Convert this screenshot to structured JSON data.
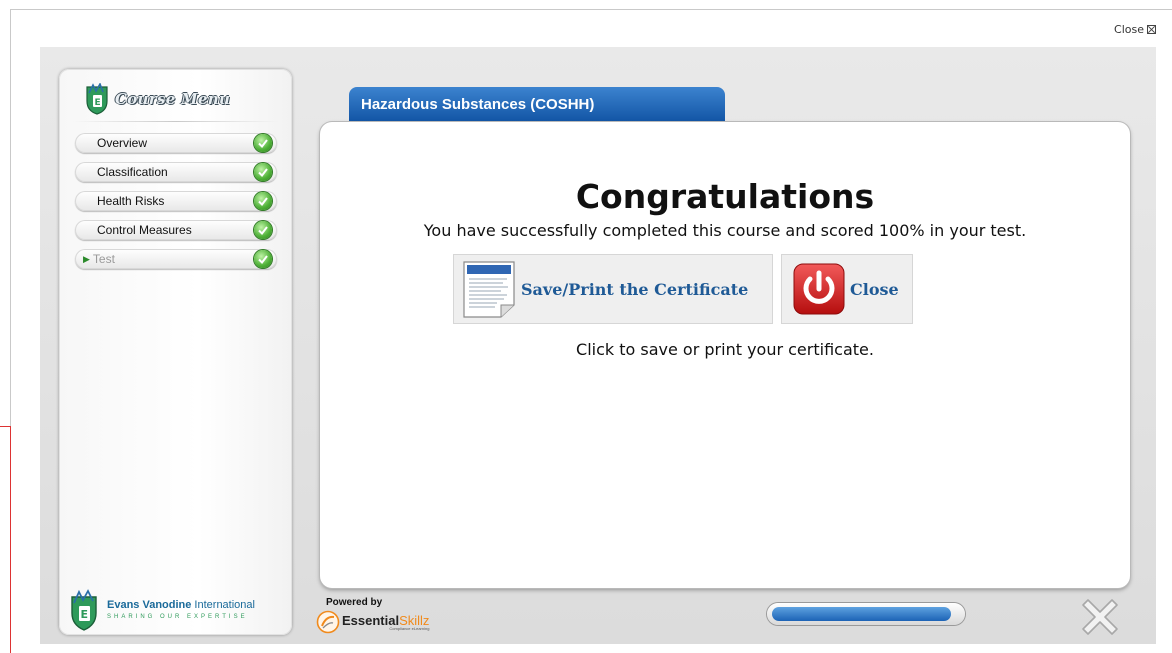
{
  "top_close": {
    "label": "Close"
  },
  "sidebar": {
    "title": "Course Menu",
    "items": [
      {
        "label": "Overview",
        "status": "complete",
        "current": false
      },
      {
        "label": "Classification",
        "status": "complete",
        "current": false
      },
      {
        "label": "Health Risks",
        "status": "complete",
        "current": false
      },
      {
        "label": "Control Measures",
        "status": "complete",
        "current": false
      },
      {
        "label": "Test",
        "status": "complete",
        "current": true
      }
    ],
    "brand": {
      "name_bold": "Evans Vanodine",
      "name_rest": " International",
      "tagline": "SHARING OUR EXPERTISE"
    }
  },
  "course": {
    "title": "Hazardous Substances (COSHH)"
  },
  "result": {
    "heading": "Congratulations",
    "message": "You have successfully completed this course and scored 100% in your test.",
    "certificate_button": "Save/Print the Certificate",
    "close_button": "Close",
    "hint": "Click to save or print your certificate."
  },
  "footer": {
    "powered_by": "Powered by",
    "logo_main": "Essential",
    "logo_accent": "Skillz",
    "logo_sub": "Compliance eLearning",
    "progress": 0.95
  },
  "colors": {
    "tab_blue": "#1356a6",
    "check_green": "#4caf35",
    "close_red": "#d42222",
    "accent_orange": "#f08a1c"
  }
}
